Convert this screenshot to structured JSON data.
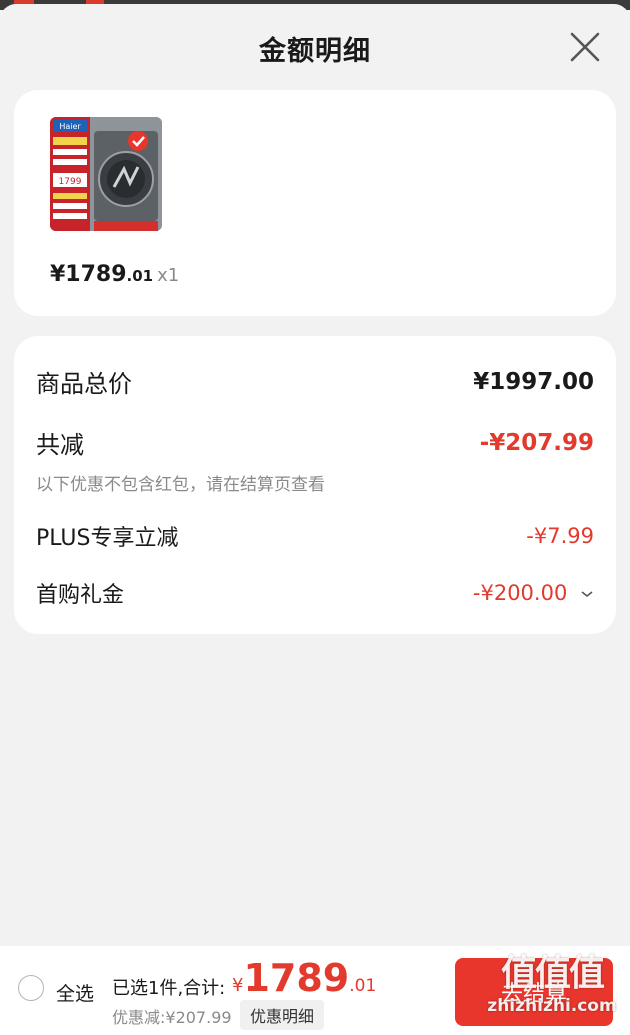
{
  "header": {
    "title": "金额明细"
  },
  "product": {
    "price_int": "¥1789",
    "price_cents": ".01",
    "quantity": "x1",
    "thumbnail": {
      "brand": "Haier",
      "badge_price": "1799"
    }
  },
  "summary": {
    "total_label": "商品总价",
    "total_value": "¥1997.00",
    "reduction_label": "共减",
    "reduction_value": "-¥207.99",
    "note": "以下优惠不包含红包，请在结算页查看",
    "plus_label": "PLUS专享立减",
    "plus_value": "-¥7.99",
    "first_buy_label": "首购礼金",
    "first_buy_value": "-¥200.00"
  },
  "bottom_bar": {
    "select_all": "全选",
    "selected_info": "已选1件,合计:",
    "total_yen": "¥",
    "total_int": "1789",
    "total_cents": ".01",
    "discount": "优惠减:¥207.99",
    "detail_button": "优惠明细",
    "checkout_button": "去结算"
  },
  "watermark": {
    "big": "值值值",
    "small": "zhizhizhi.com"
  },
  "colors": {
    "accent_red": "#e23a2c",
    "checkout_red": "#e8362c",
    "background": "#f2f2f2"
  }
}
